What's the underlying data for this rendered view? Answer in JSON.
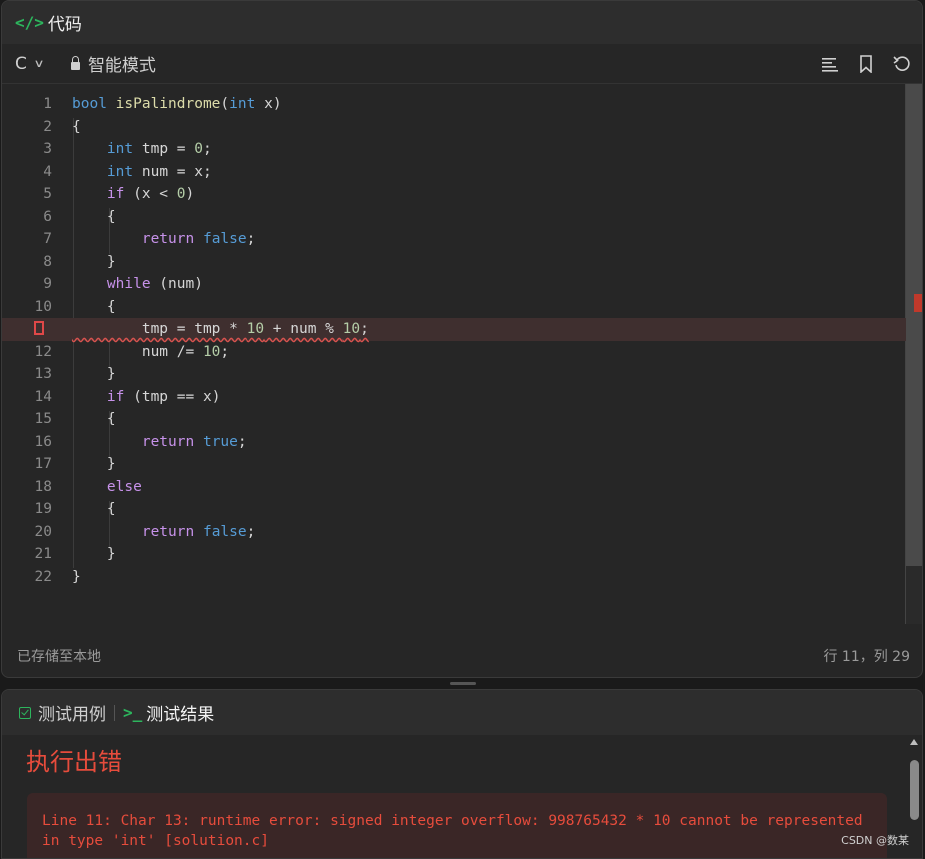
{
  "header": {
    "title": "代码",
    "icon": "code-icon"
  },
  "toolbar": {
    "language": "C",
    "mode_label": "智能模式",
    "icons": [
      "format-icon",
      "bookmark-icon",
      "reset-icon"
    ]
  },
  "code_lines": [
    "bool isPalindrome(int x)",
    "{",
    "    int tmp = 0;",
    "    int num = x;",
    "    if (x < 0)",
    "    {",
    "        return false;",
    "    }",
    "    while (num)",
    "    {",
    "        tmp = tmp * 10 + num % 10;",
    "        num /= 10;",
    "    }",
    "    if (tmp == x)",
    "    {",
    "        return true;",
    "    }",
    "    else",
    "    {",
    "        return false;",
    "    }",
    "}"
  ],
  "error_line": 11,
  "status": {
    "saved": "已存储至本地",
    "position": "行 11，列 29"
  },
  "bottom_tabs": [
    {
      "label": "测试用例",
      "icon": "checkbox-icon"
    },
    {
      "label": "测试结果",
      "icon": "terminal-icon",
      "active": true
    }
  ],
  "result": {
    "title": "执行出错",
    "message": "Line 11: Char 13: runtime error: signed integer overflow: 998765432 * 10 cannot be represented in type 'int' [solution.c]"
  },
  "watermark": "CSDN @数某",
  "colors": {
    "accent": "#2db55d",
    "error": "#e74c3c",
    "bg": "#262626"
  }
}
